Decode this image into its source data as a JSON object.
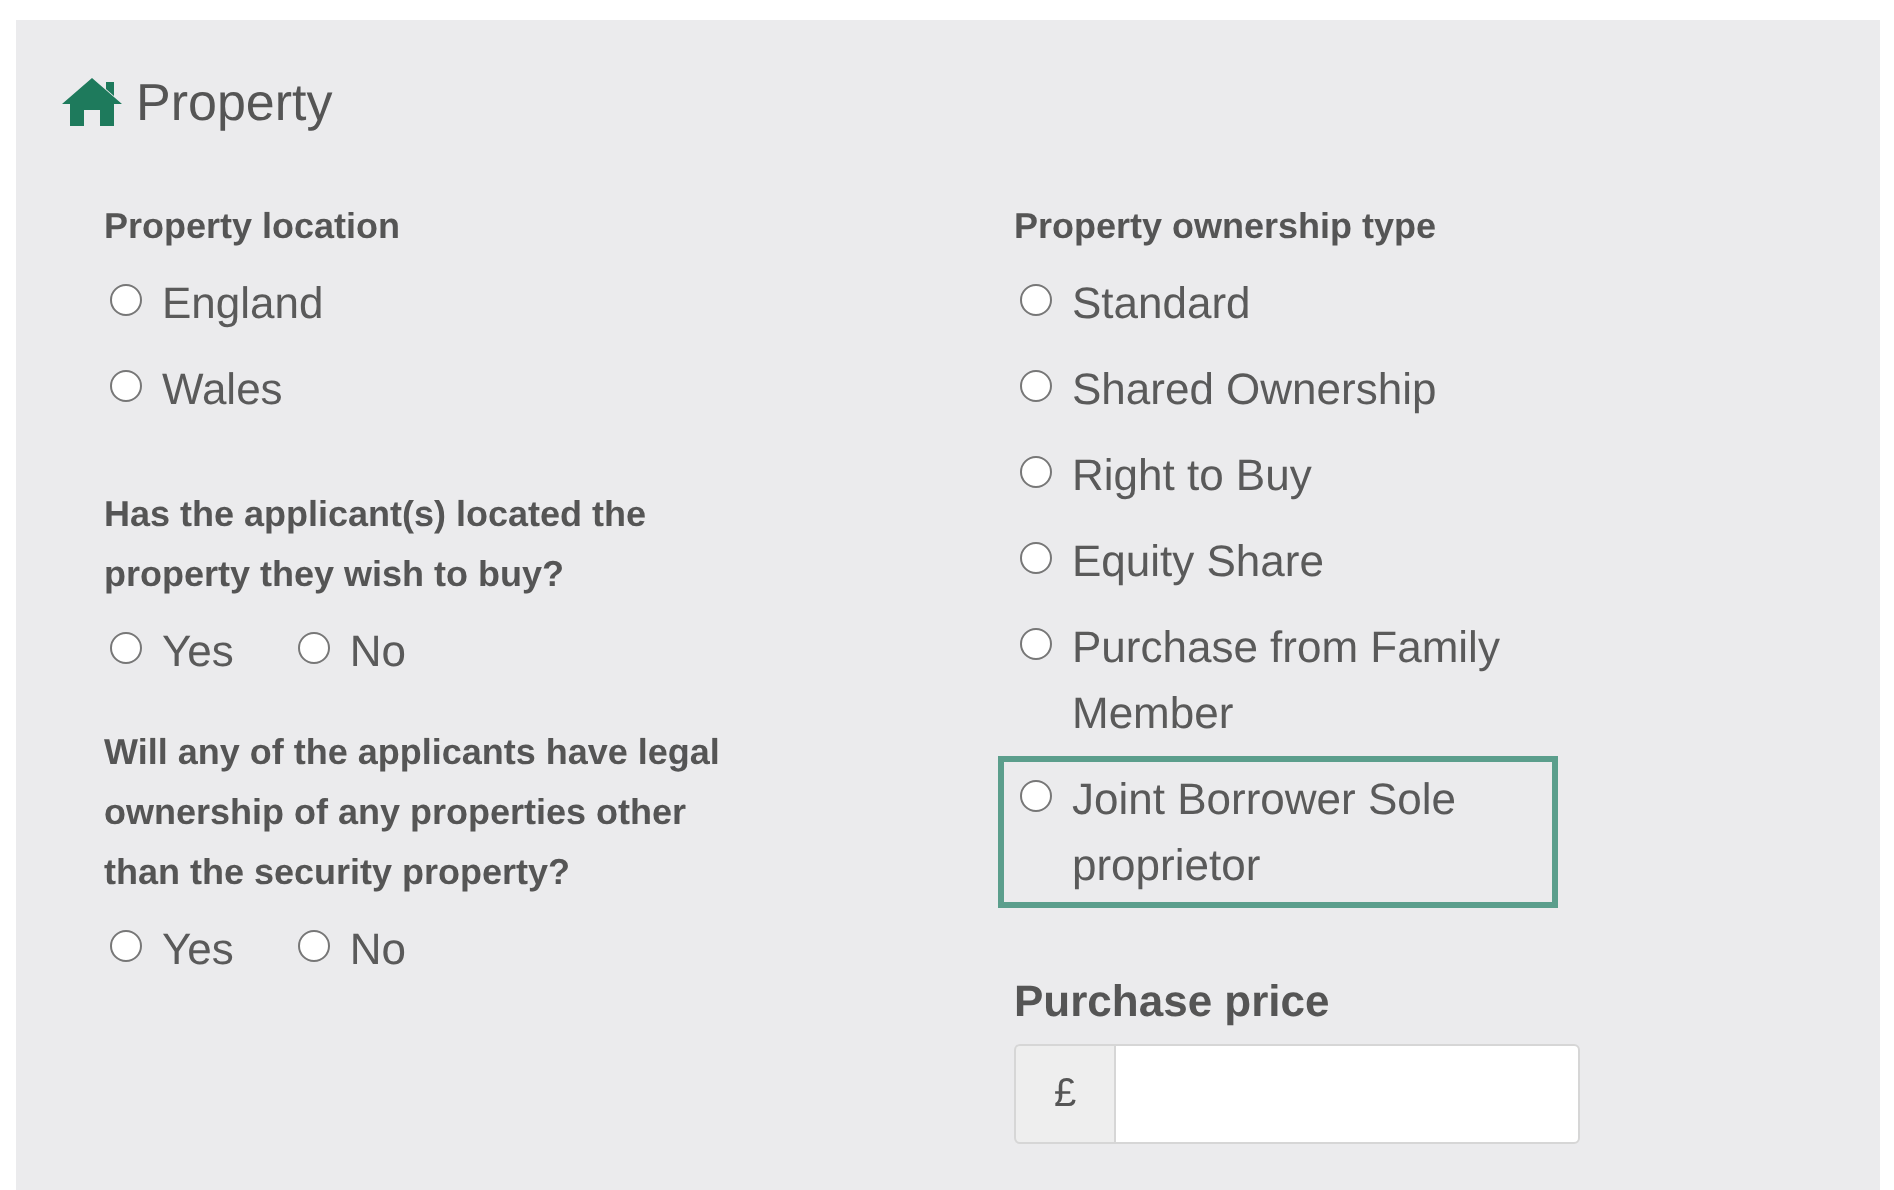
{
  "section": {
    "title": "Property"
  },
  "left": [
    {
      "kind": "radio_list",
      "label": "Property location",
      "options": [
        {
          "label": "England",
          "selected": false
        },
        {
          "label": "Wales",
          "selected": false
        }
      ]
    },
    {
      "kind": "radio_row",
      "label": "Has the applicant(s) located the property they wish to buy?",
      "options": [
        {
          "label": "Yes",
          "selected": false
        },
        {
          "label": "No",
          "selected": false
        }
      ]
    },
    {
      "kind": "radio_row",
      "label": "Will any of the applicants have legal ownership of any properties other than the security property?",
      "options": [
        {
          "label": "Yes",
          "selected": false
        },
        {
          "label": "No",
          "selected": false
        }
      ]
    }
  ],
  "right": [
    {
      "kind": "radio_list",
      "label": "Property ownership type",
      "options": [
        {
          "label": "Standard",
          "selected": false,
          "highlighted": false
        },
        {
          "label": "Shared Ownership",
          "selected": false,
          "highlighted": false
        },
        {
          "label": "Right to Buy",
          "selected": false,
          "highlighted": false
        },
        {
          "label": "Equity Share",
          "selected": false,
          "highlighted": false
        },
        {
          "label": "Purchase from Family Member",
          "selected": false,
          "highlighted": false
        },
        {
          "label": "Joint Borrower Sole proprietor",
          "selected": false,
          "highlighted": true
        }
      ]
    },
    {
      "kind": "currency_field",
      "label": "Purchase price",
      "prefix": "£"
    }
  ]
}
